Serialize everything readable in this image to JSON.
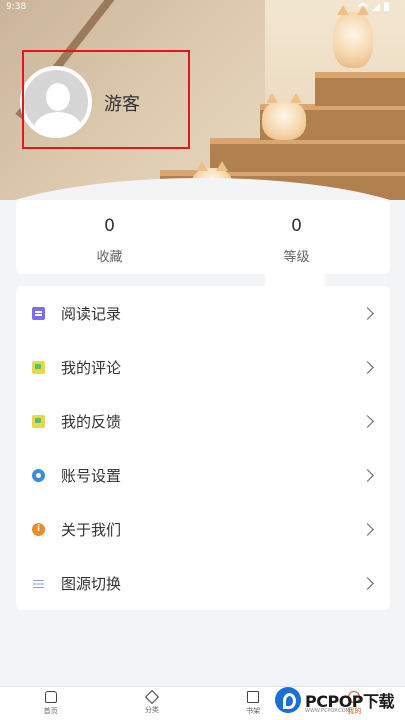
{
  "status_bar": {
    "time": "9:38"
  },
  "profile": {
    "username": "游客"
  },
  "stats": [
    {
      "value": "0",
      "label": "收藏"
    },
    {
      "value": "0",
      "label": "等级"
    }
  ],
  "menu": [
    {
      "label": "阅读记录",
      "icon": "book-icon"
    },
    {
      "label": "我的评论",
      "icon": "comment-icon"
    },
    {
      "label": "我的反馈",
      "icon": "feedback-icon"
    },
    {
      "label": "账号设置",
      "icon": "gear-icon"
    },
    {
      "label": "关于我们",
      "icon": "info-icon"
    },
    {
      "label": "图源切换",
      "icon": "list-icon"
    }
  ],
  "tabs": [
    {
      "label": "首页",
      "icon": "home-icon"
    },
    {
      "label": "分类",
      "icon": "category-icon"
    },
    {
      "label": "书架",
      "icon": "bookshelf-icon"
    },
    {
      "label": "我的",
      "icon": "profile-icon",
      "active": true
    }
  ],
  "watermark": {
    "text": "PCPOP下载",
    "subtext": "WWW.PCPOP.COM"
  },
  "colors": {
    "accent": "#e6571c",
    "highlight_box": "#e01818"
  }
}
